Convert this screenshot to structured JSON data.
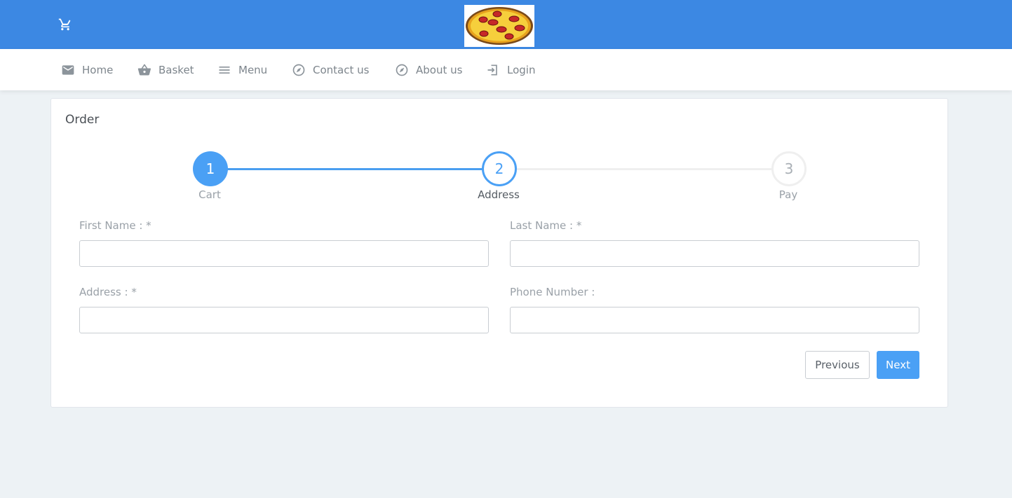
{
  "colors": {
    "topbar": "#3c88e3",
    "accent": "#4aa0f5",
    "background": "#edf2f5",
    "inactive_step": "#eeeeee"
  },
  "header": {
    "cart_icon": "shopping-cart-icon",
    "logo": "pizza-logo"
  },
  "nav": {
    "items": [
      {
        "label": "Home",
        "icon": "envelope-icon"
      },
      {
        "label": "Basket",
        "icon": "basket-icon"
      },
      {
        "label": "Menu",
        "icon": "hamburger-menu-icon"
      },
      {
        "label": "Contact us",
        "icon": "compass-icon"
      },
      {
        "label": "About us",
        "icon": "compass-icon"
      },
      {
        "label": "Login",
        "icon": "login-icon"
      }
    ]
  },
  "order": {
    "title": "Order",
    "steps": [
      {
        "number": "1",
        "label": "Cart",
        "state": "completed"
      },
      {
        "number": "2",
        "label": "Address",
        "state": "active"
      },
      {
        "number": "3",
        "label": "Pay",
        "state": "pending"
      }
    ],
    "fields": {
      "first_name": {
        "label": "First Name : *",
        "value": ""
      },
      "last_name": {
        "label": "Last Name : *",
        "value": ""
      },
      "address": {
        "label": "Address : *",
        "value": ""
      },
      "phone": {
        "label": "Phone Number :",
        "value": ""
      }
    },
    "buttons": {
      "previous": "Previous",
      "next": "Next"
    }
  }
}
